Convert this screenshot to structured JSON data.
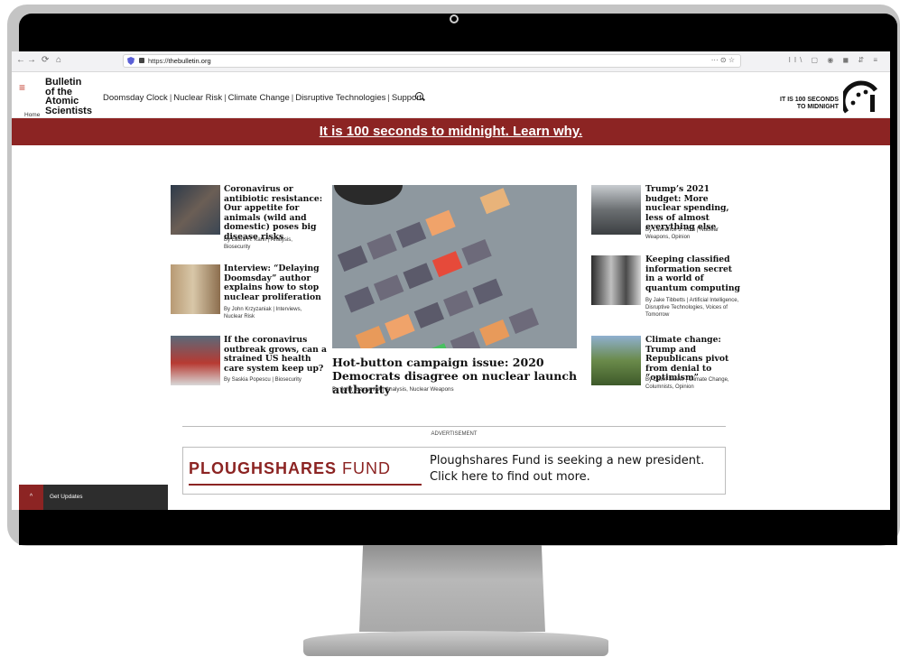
{
  "browser": {
    "back": "←",
    "forward": "→",
    "reload": "⟳",
    "home": "⌂",
    "url_prefix": "https://",
    "url_host": "thebulletin.org",
    "url_actions": "··· ⊙ ☆",
    "toolbar_icons": "II\\ ▢ ◉ ◼ ⇵ ≡"
  },
  "header": {
    "menu_icon": "≡",
    "logo": [
      "Bulletin",
      "of the",
      "Atomic",
      "Scientists"
    ],
    "nav": [
      "Doomsday Clock",
      "Nuclear Risk",
      "Climate Change",
      "Disruptive Technologies",
      "Support"
    ],
    "clock_line1": "IT IS 100 SECONDS",
    "clock_line2": "TO MIDNIGHT"
  },
  "breadcrumb": "Home",
  "banner": "It is 100 seconds to midnight. Learn why.",
  "left_articles": [
    {
      "title": "Coronavirus or antibiotic resistance: Our appetite for animals (wild and domestic) poses big disease risks",
      "byline": "By Laura H. Kahn | Analysis, Biosecurity"
    },
    {
      "title": "Interview: “Delaying Doomsday” author explains how to stop nuclear proliferation",
      "byline": "By John Krzyzaniak | Interviews, Nuclear Risk"
    },
    {
      "title": "If the coronavirus outbreak grows, can a strained US health care system keep up?",
      "byline": "By Saskia Popescu | Biosecurity"
    }
  ],
  "hero": {
    "title": "Hot-button campaign issue: 2020 Democrats disagree on nuclear launch authority",
    "byline": "By John Krzyzaniak | Analysis, Nuclear Weapons"
  },
  "right_articles": [
    {
      "title": "Trump’s 2021 budget: More nuclear spending, less of almost everything else",
      "byline": "By Lawrence J. Korb | Nuclear Weapons, Opinion"
    },
    {
      "title": "Keeping classified information secret in a world of quantum computing",
      "byline": "By Jake Tibbetts | Artificial Intelligence, Disruptive Technologies, Voices of Tomorrow"
    },
    {
      "title": "Climate change: Trump and Republicans pivot from denial to “optimism”",
      "byline": "By Dawn Stover | Climate Change, Columnists, Opinion"
    }
  ],
  "ad": {
    "label": "ADVERTISEMENT",
    "logo_bold": "PLOUGHSHARES",
    "logo_light": "FUND",
    "text_line1": "Ploughshares Fund is seeking a new president.",
    "text_line2": "Click here to find out more."
  },
  "updates": {
    "caret": "^",
    "label": "Get Updates"
  },
  "colors": {
    "brand_red": "#8c2423"
  }
}
